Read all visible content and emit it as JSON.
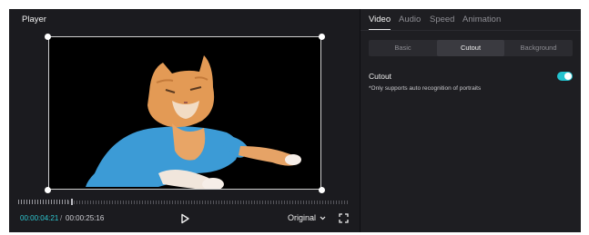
{
  "player": {
    "title": "Player",
    "time_current": "00:00:04:21",
    "time_separator": "/",
    "time_total": "00:00:25:16",
    "ratio_label": "Original",
    "icons": [
      "play-icon",
      "chevron-down-icon",
      "fullscreen-icon"
    ]
  },
  "side_panel": {
    "tabs": [
      {
        "label": "Video",
        "active": true
      },
      {
        "label": "Audio",
        "active": false
      },
      {
        "label": "Speed",
        "active": false
      },
      {
        "label": "Animation",
        "active": false
      }
    ],
    "segments": [
      {
        "label": "Basic",
        "active": false
      },
      {
        "label": "Cutout",
        "active": true
      },
      {
        "label": "Background",
        "active": false
      }
    ],
    "cutout": {
      "label": "Cutout",
      "note": "*Only supports auto recognition of portraits",
      "enabled": true
    }
  },
  "colors": {
    "accent": "#23c3cf",
    "timecode": "#2ec6d0",
    "panel_bg": "#1e1e22",
    "player_bg": "#1b1b1f"
  }
}
